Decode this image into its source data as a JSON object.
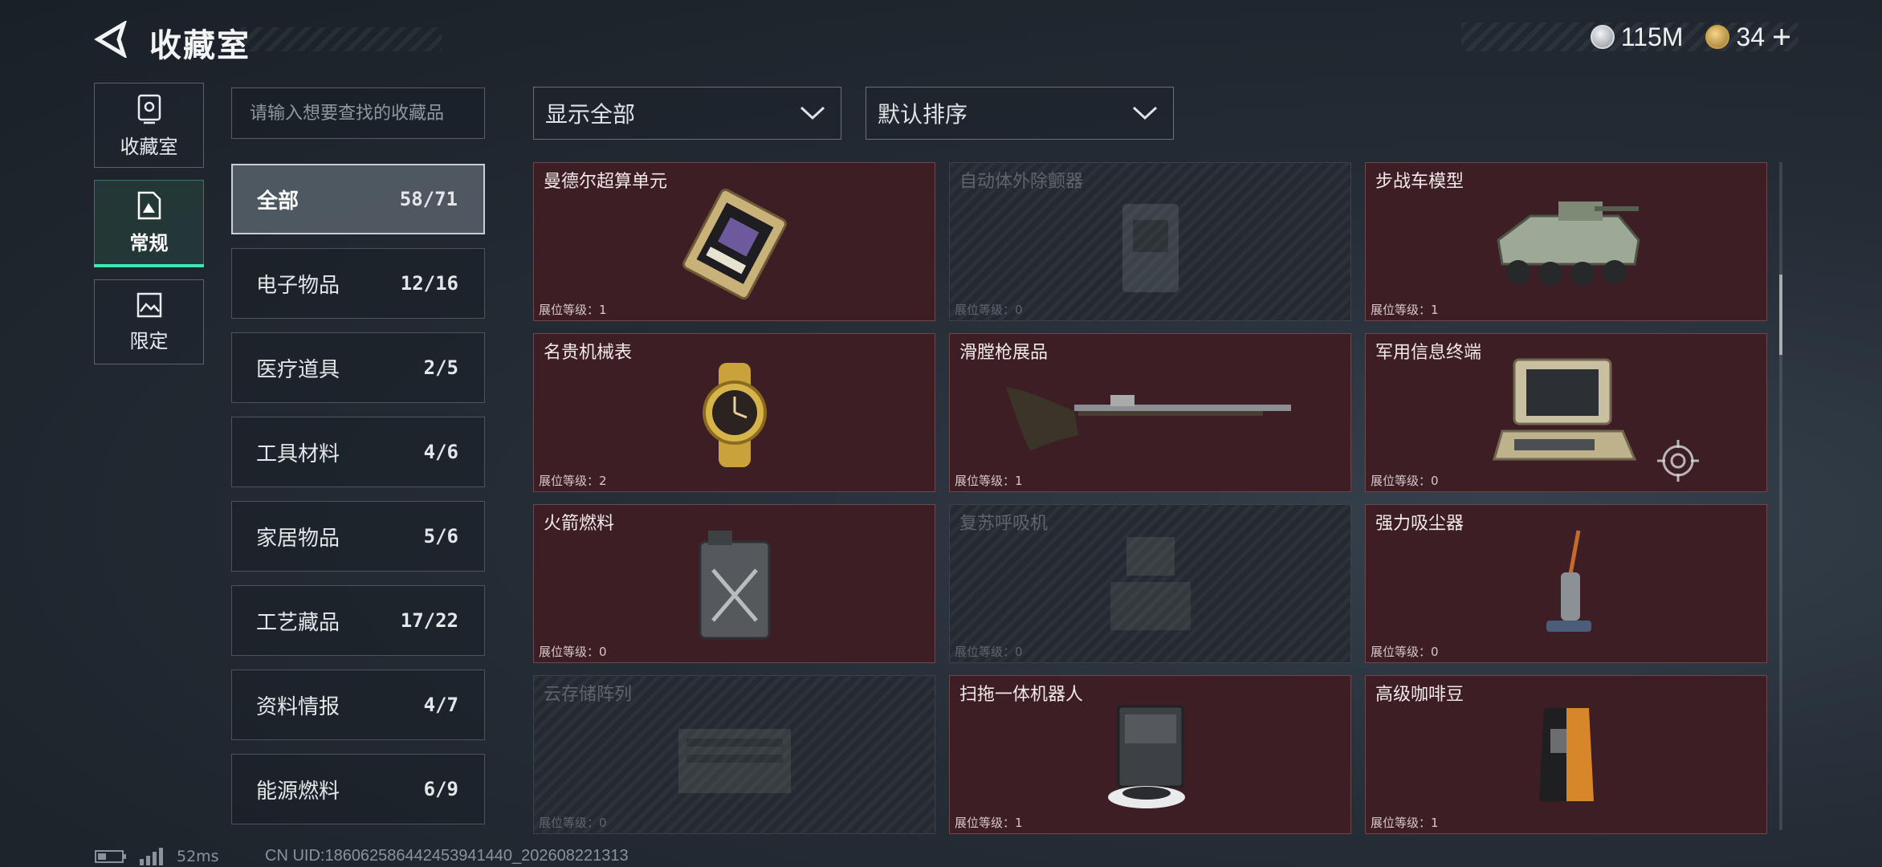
{
  "header": {
    "title": "收藏室"
  },
  "currency": [
    {
      "icon": "silver-coin-icon",
      "value": "115M"
    },
    {
      "icon": "gold-coin-icon",
      "value": "34"
    }
  ],
  "rail": [
    {
      "label": "收藏室",
      "icon": "safe-icon"
    },
    {
      "label": "常规",
      "icon": "document-icon"
    },
    {
      "label": "限定",
      "icon": "image-icon"
    }
  ],
  "search": {
    "placeholder": "请输入想要查找的收藏品"
  },
  "categories": [
    {
      "name": "全部",
      "count": "58/71"
    },
    {
      "name": "电子物品",
      "count": "12/16"
    },
    {
      "name": "医疗道具",
      "count": "2/5"
    },
    {
      "name": "工具材料",
      "count": "4/6"
    },
    {
      "name": "家居物品",
      "count": "5/6"
    },
    {
      "name": "工艺藏品",
      "count": "17/22"
    },
    {
      "name": "资料情报",
      "count": "4/7"
    },
    {
      "name": "能源燃料",
      "count": "6/9"
    }
  ],
  "filters": {
    "show": "显示全部",
    "sort": "默认排序"
  },
  "level_label": "展位等级：",
  "items": [
    {
      "title": "曼德尔超算单元",
      "level": "1",
      "locked": false,
      "icon": "supercomputer-icon"
    },
    {
      "title": "自动体外除颤器",
      "level": "0",
      "locked": true,
      "icon": "defibrillator-icon"
    },
    {
      "title": "步战车模型",
      "level": "1",
      "locked": false,
      "icon": "ifv-model-icon"
    },
    {
      "title": "名贵机械表",
      "level": "2",
      "locked": false,
      "icon": "watch-icon"
    },
    {
      "title": "滑膛枪展品",
      "level": "1",
      "locked": false,
      "icon": "musket-icon"
    },
    {
      "title": "军用信息终端",
      "level": "0",
      "locked": false,
      "icon": "terminal-icon"
    },
    {
      "title": "火箭燃料",
      "level": "0",
      "locked": false,
      "icon": "fuel-can-icon"
    },
    {
      "title": "复苏呼吸机",
      "level": "0",
      "locked": true,
      "icon": "ventilator-icon"
    },
    {
      "title": "强力吸尘器",
      "level": "0",
      "locked": false,
      "icon": "vacuum-icon"
    },
    {
      "title": "云存储阵列",
      "level": "0",
      "locked": true,
      "icon": "storage-array-icon"
    },
    {
      "title": "扫拖一体机器人",
      "level": "1",
      "locked": false,
      "icon": "robot-mop-icon"
    },
    {
      "title": "高级咖啡豆",
      "level": "1",
      "locked": false,
      "icon": "coffee-bag-icon"
    }
  ],
  "status": {
    "ping": "52ms",
    "uid": "CN UID:1860625864424539414​40_202608221313"
  }
}
